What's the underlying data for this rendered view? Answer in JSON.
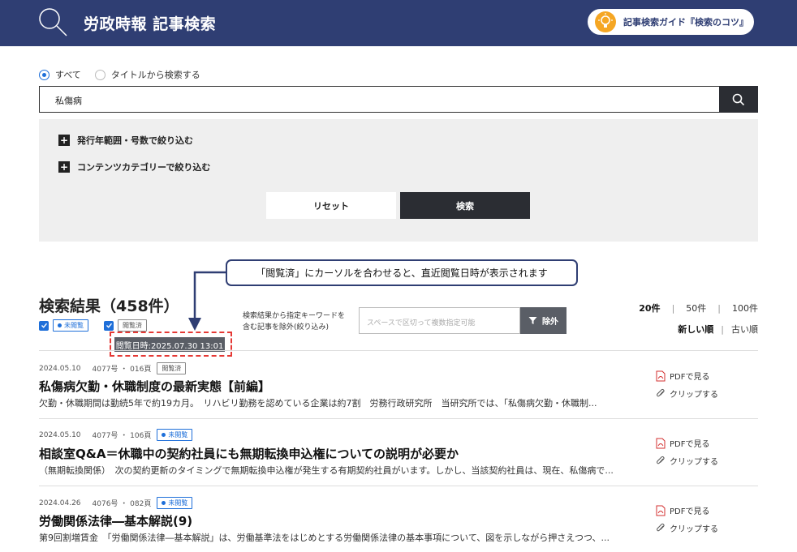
{
  "header": {
    "app_title": "労政時報 記事検索",
    "guide_label": "記事検索ガイド『検索のコツ』"
  },
  "search": {
    "radio_all": "すべて",
    "radio_title": "タイトルから検索する",
    "query": "私傷病"
  },
  "filters": {
    "year_range": "発行年範囲・号数で絞り込む",
    "category": "コンテンツカテゴリーで絞り込む",
    "reset": "リセット",
    "submit": "検索"
  },
  "callout": "「閲覧済」にカーソルを合わせると、直近閲覧日時が表示されます",
  "results": {
    "title": "検索結果（458件）",
    "legend_unread": "未閲覧",
    "legend_read": "閲覧済",
    "tooltip": "閲覧日時:2025.07.30 13:01",
    "exclude_label_1": "検索結果から指定キーワードを",
    "exclude_label_2": "含む記事を除外(絞り込み)",
    "exclude_placeholder": "スペースで区切って複数指定可能",
    "exclude_button": "除外",
    "per_page": [
      "20件",
      "50件",
      "100件"
    ],
    "sort": [
      "新しい順",
      "古い順"
    ]
  },
  "items": [
    {
      "date": "2024.05.10",
      "issue": "4077号 ・ 016頁",
      "status": "閲覧済",
      "title": "私傷病欠勤・休職制度の最新実態【前編】",
      "snippet": "欠勤・休職期間は勤続5年で約19カ月。　リハビリ勤務を認めている企業は約7割　労務行政研究所　当研究所では、「私傷病欠勤・休職制...",
      "pdf": "PDFで見る",
      "clip": "クリップする"
    },
    {
      "date": "2024.05.10",
      "issue": "4077号 ・ 106頁",
      "status": "未閲覧",
      "title": "相談室Q&A＝休職中の契約社員にも無期転換申込権についての説明が必要か",
      "snippet": "（無期転換関係）　次の契約更新のタイミングで無期転換申込権が発生する有期契約社員がいます。しかし、当該契約社員は、現在、私傷病で...",
      "pdf": "PDFで見る",
      "clip": "クリップする"
    },
    {
      "date": "2024.04.26",
      "issue": "4076号 ・ 082頁",
      "status": "未閲覧",
      "title": "労働関係法律―基本解説(9)",
      "snippet": "第9回割増賃金　「労働関係法律―基本解説」は、労働基準法をはじめとする労働関係法律の基本事項について、図を示しながら押さえつつ、...",
      "pdf": "PDFで見る",
      "clip": "クリップする"
    }
  ],
  "colors": {
    "brand_navy": "#2f3e73",
    "accent_blue": "#1e6fd9",
    "dark_button": "#2b2d33",
    "highlight_red": "#e53935"
  }
}
